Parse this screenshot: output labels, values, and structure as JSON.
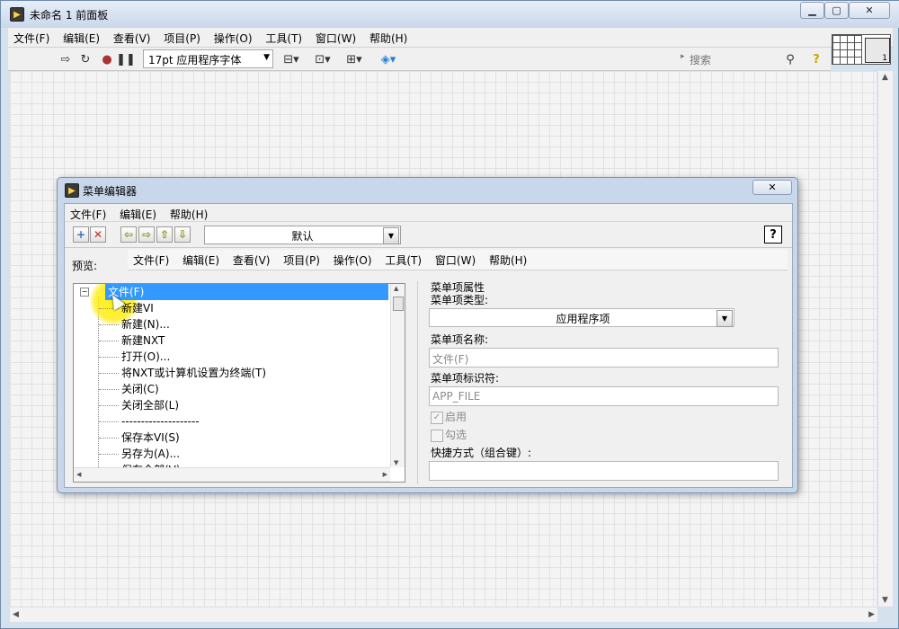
{
  "window": {
    "title": "未命名 1 前面板",
    "icon": "labview-icon",
    "controls": [
      "minimize-icon",
      "maximize-icon",
      "close-icon"
    ]
  },
  "menubar": [
    "文件(F)",
    "编辑(E)",
    "查看(V)",
    "项目(P)",
    "操作(O)",
    "工具(T)",
    "窗口(W)",
    "帮助(H)"
  ],
  "toolbar": {
    "font": "17pt 应用程序字体",
    "search_placeholder": "搜索",
    "icons": [
      "run-arrow-icon",
      "run-continuous-icon",
      "abort-icon",
      "pause-icon",
      "align-icon",
      "distribute-icon",
      "resize-icon",
      "reorder-icon",
      "search-icon",
      "help-icon"
    ]
  },
  "vi_icon_number": "1",
  "dialog": {
    "title": "菜单编辑器",
    "menubar": [
      "文件(F)",
      "编辑(E)",
      "帮助(H)"
    ],
    "type_select": "默认",
    "help_label": "?",
    "preview_label": "预览:",
    "preview_menu": [
      "文件(F)",
      "编辑(E)",
      "查看(V)",
      "项目(P)",
      "操作(O)",
      "工具(T)",
      "窗口(W)",
      "帮助(H)"
    ],
    "tree": {
      "root": "文件(F)",
      "items": [
        "新建VI",
        "新建(N)...",
        "新建NXT",
        "打开(O)...",
        "将NXT或计算机设置为终端(T)",
        "关闭(C)",
        "关闭全部(L)",
        "--------------------",
        "保存本VI(S)",
        "另存为(A)...",
        "保存全部(V)"
      ]
    },
    "properties": {
      "group_title": "菜单项属性",
      "item_type_label": "菜单项类型:",
      "item_type_value": "应用程序项",
      "item_name_label": "菜单项名称:",
      "item_name_value": "文件(F)",
      "item_tag_label": "菜单项标识符:",
      "item_tag_value": "APP_FILE",
      "enabled_label": "启用",
      "checked_label": "勾选",
      "shortcut_label": "快捷方式（组合键）:",
      "shortcut_value": ""
    }
  }
}
